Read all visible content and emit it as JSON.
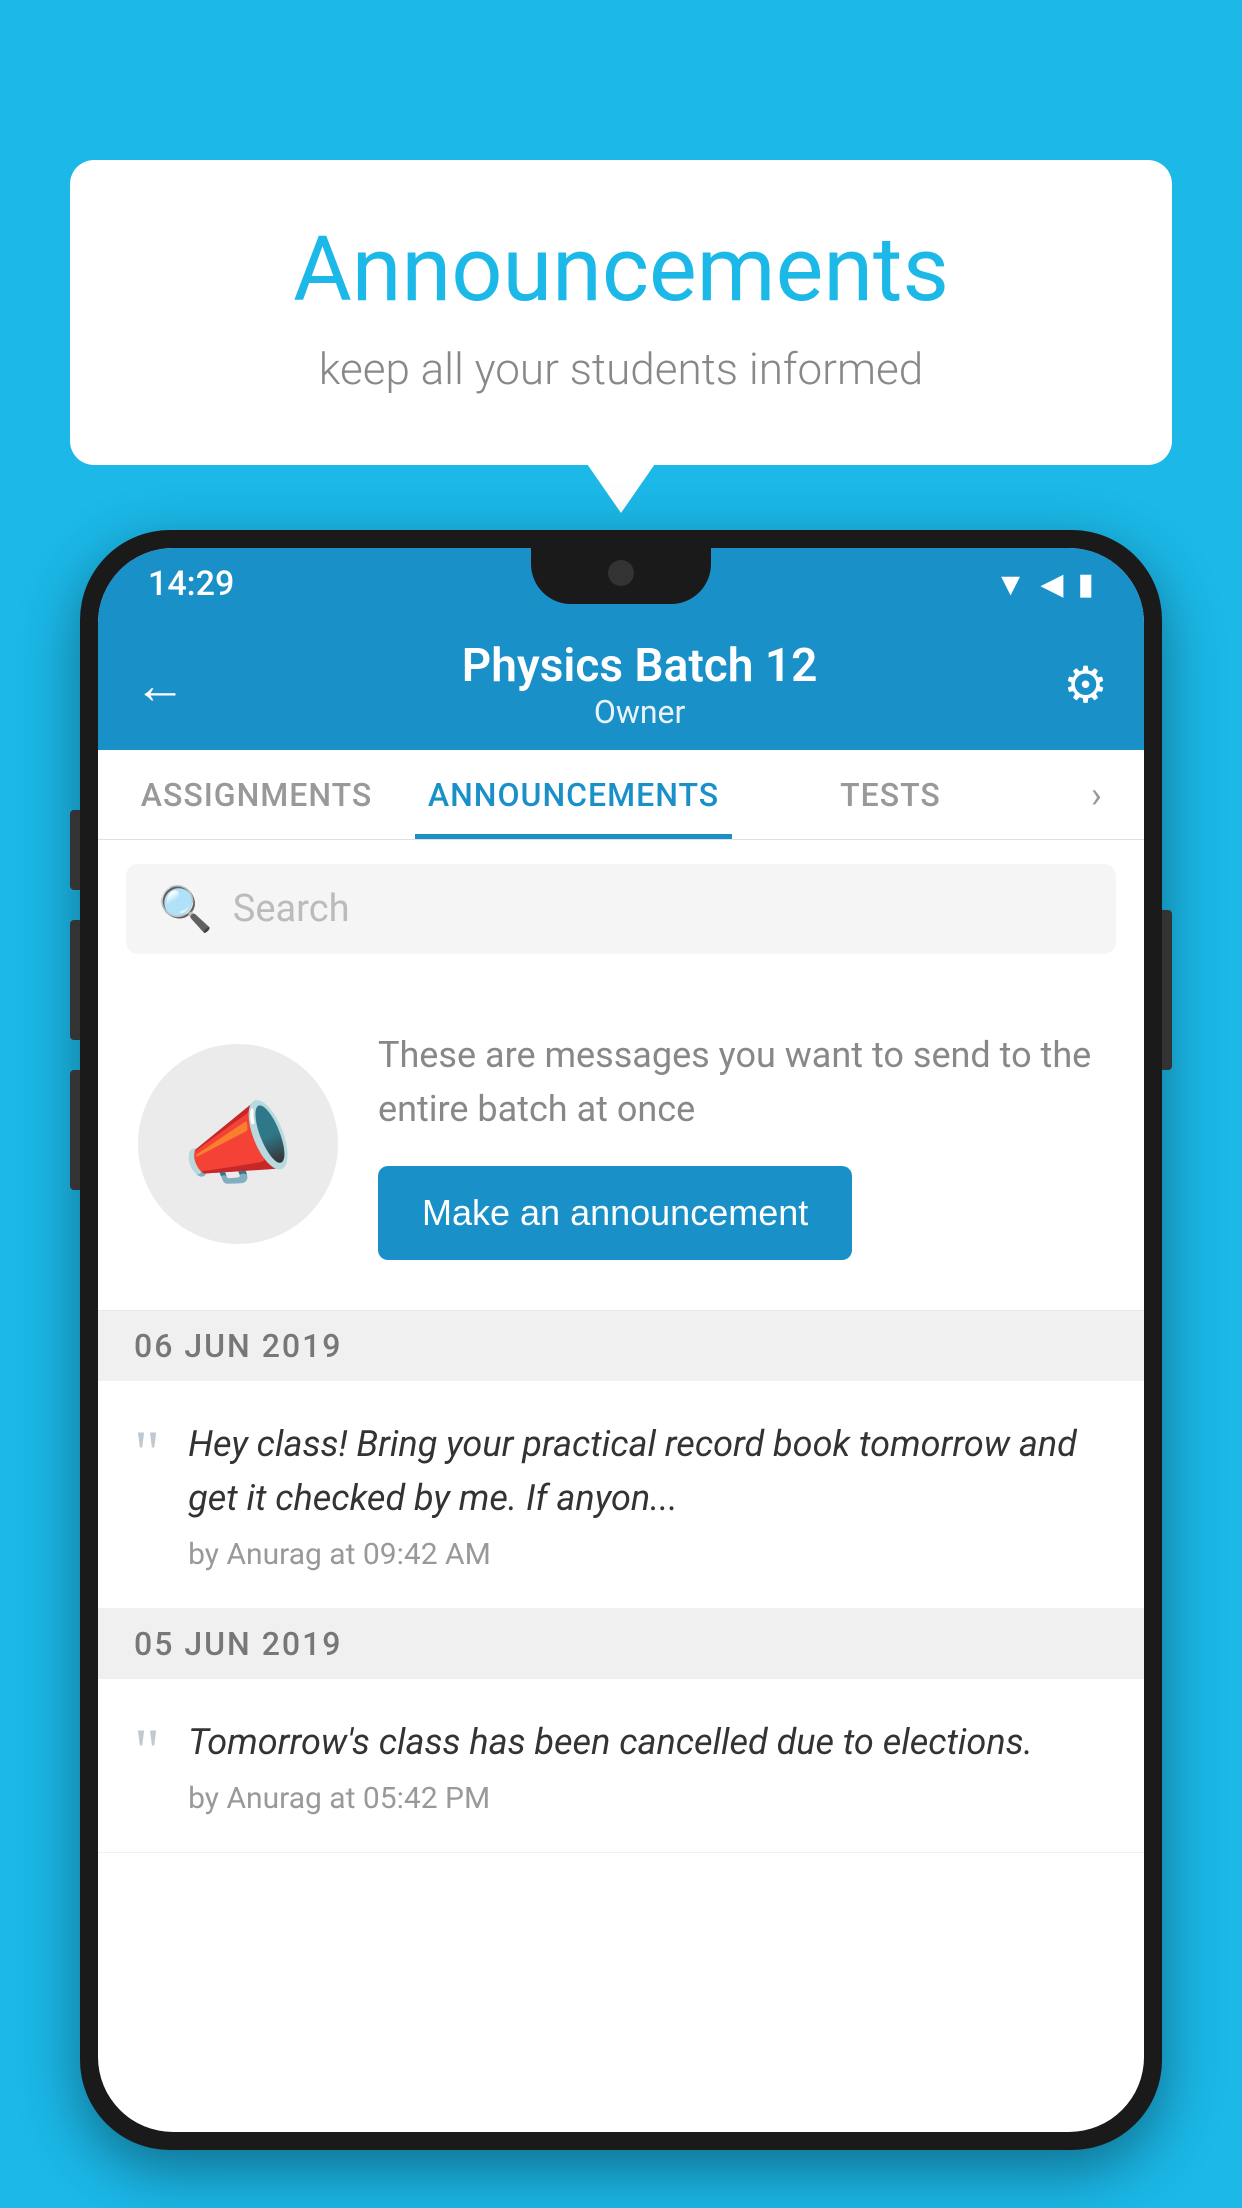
{
  "background_color": "#1bb8e8",
  "speech_bubble": {
    "title": "Announcements",
    "subtitle": "keep all your students informed"
  },
  "phone": {
    "status_bar": {
      "time": "14:29",
      "icons": [
        "wifi",
        "signal",
        "battery"
      ]
    },
    "app_bar": {
      "title": "Physics Batch 12",
      "subtitle": "Owner",
      "back_label": "←",
      "settings_label": "⚙"
    },
    "tabs": [
      {
        "label": "ASSIGNMENTS",
        "active": false
      },
      {
        "label": "ANNOUNCEMENTS",
        "active": true
      },
      {
        "label": "TESTS",
        "active": false
      }
    ],
    "search": {
      "placeholder": "Search"
    },
    "announcement_promo": {
      "description": "These are messages you want to send to the entire batch at once",
      "button_label": "Make an announcement"
    },
    "date_sections": [
      {
        "date": "06  JUN  2019",
        "messages": [
          {
            "text": "Hey class! Bring your practical record book tomorrow and get it checked by me. If anyon...",
            "meta": "by Anurag at 09:42 AM"
          }
        ]
      },
      {
        "date": "05  JUN  2019",
        "messages": [
          {
            "text": "Tomorrow's class has been cancelled due to elections.",
            "meta": "by Anurag at 05:42 PM"
          }
        ]
      }
    ]
  }
}
